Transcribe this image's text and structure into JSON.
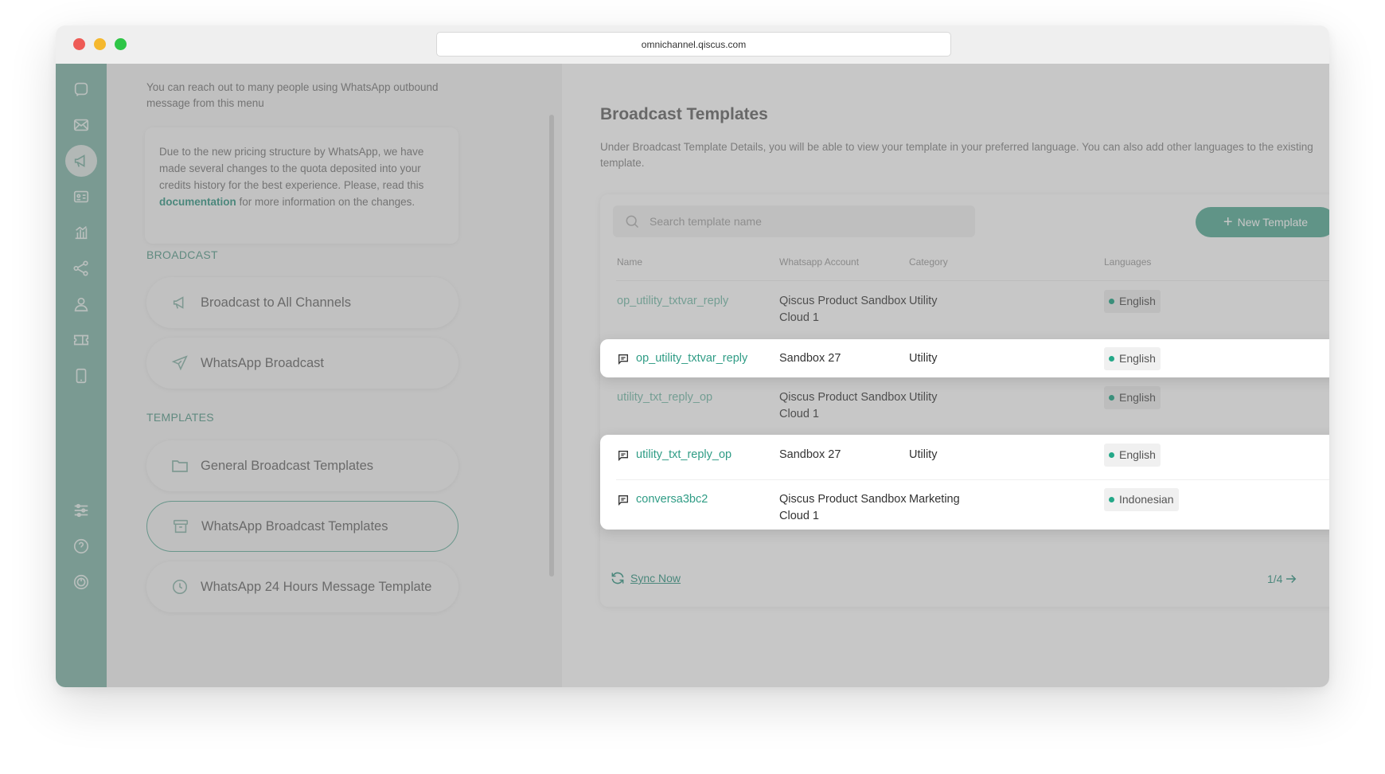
{
  "browser": {
    "url": "omnichannel.qiscus.com"
  },
  "menu": {
    "intro": "You can reach out to many people using WhatsApp outbound message from this menu",
    "notice_before": "Due to the new pricing structure by WhatsApp, we have made several changes to the quota deposited into your credits history for the best experience. Please, read this ",
    "notice_link": "documentation",
    "notice_after": " for more information on the changes.",
    "broadcast_label": "BROADCAST",
    "broadcast_items": [
      "Broadcast to All Channels",
      "WhatsApp Broadcast"
    ],
    "templates_label": "TEMPLATES",
    "template_items": [
      "General Broadcast Templates",
      "WhatsApp Broadcast Templates",
      "WhatsApp 24 Hours Message Template"
    ]
  },
  "main": {
    "title": "Broadcast Templates",
    "description": "Under Broadcast Template Details, you will be able to view your template in your preferred language. You can also add other languages to the existing template.",
    "search_placeholder": "Search template name",
    "new_button": "New Template",
    "columns": [
      "Name",
      "Whatsapp Account",
      "Category",
      "Languages"
    ],
    "rows": [
      {
        "name": "op_utility_txtvar_reply",
        "account_1": "Qiscus Product Sandbox",
        "account_2": "Cloud 1",
        "category": "Utility",
        "language": "English"
      },
      {
        "name": "op_utility_txtvar_reply",
        "account_1": "Sandbox 27",
        "account_2": "",
        "category": "Utility",
        "language": "English"
      },
      {
        "name": "utility_txt_reply_op",
        "account_1": "Qiscus Product Sandbox",
        "account_2": "Cloud 1",
        "category": "Utility",
        "language": "English"
      },
      {
        "name": "utility_txt_reply_op",
        "account_1": "Sandbox 27",
        "account_2": "",
        "category": "Utility",
        "language": "English"
      },
      {
        "name": "conversa3bc2",
        "account_1": "Qiscus Product Sandbox",
        "account_2": "Cloud 1",
        "category": "Marketing",
        "language": "Indonesian"
      }
    ],
    "sync_label": "Sync Now",
    "pagination": "1/4"
  },
  "colors": {
    "rail": "#87b9ac",
    "accent": "#3e9c8a",
    "button": "#5fb09b",
    "status_dot": "#24a888"
  }
}
